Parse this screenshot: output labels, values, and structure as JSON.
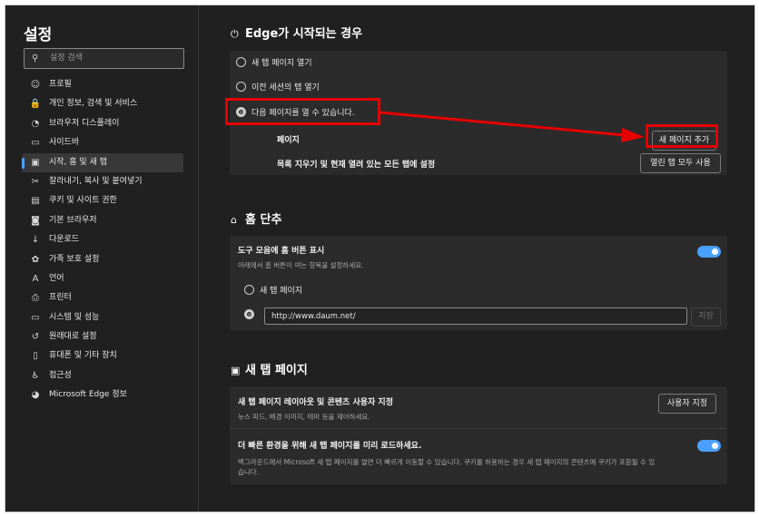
{
  "sidebar": {
    "title": "설정",
    "search_placeholder": "설정 검색",
    "items": [
      {
        "label": "프로필",
        "icon": "☺"
      },
      {
        "label": "개인 정보, 검색 및 서비스",
        "icon": "🔒"
      },
      {
        "label": "브라우저 디스플레이",
        "icon": "◔"
      },
      {
        "label": "사이드바",
        "icon": "▭"
      },
      {
        "label": "시작, 홈 및 새 탭",
        "icon": "▣"
      },
      {
        "label": "잘라내기, 복사 및 붙여넣기",
        "icon": "✂"
      },
      {
        "label": "쿠키 및 사이트 권한",
        "icon": "▤"
      },
      {
        "label": "기본 브라우저",
        "icon": "◙"
      },
      {
        "label": "다운로드",
        "icon": "↓"
      },
      {
        "label": "가족 보호 설정",
        "icon": "✿"
      },
      {
        "label": "언어",
        "icon": "A"
      },
      {
        "label": "프린터",
        "icon": "⎙"
      },
      {
        "label": "시스템 및 성능",
        "icon": "▭"
      },
      {
        "label": "원래대로 설정",
        "icon": "↺"
      },
      {
        "label": "휴대폰 및 기타 장치",
        "icon": "▯"
      },
      {
        "label": "접근성",
        "icon": "♿"
      },
      {
        "label": "Microsoft Edge 정보",
        "icon": "◕"
      }
    ]
  },
  "startup": {
    "title": "Edge가 시작되는 경우",
    "icon": "power-icon",
    "options": [
      "새 탭 페이지 열기",
      "이전 세션의 탭 열기",
      "다음 페이지를 열 수 있습니다."
    ],
    "pages_label": "페이지",
    "add_page_button": "새 페이지 추가",
    "clear_label": "목록 지우기 및 현재 열려 있는 모든 탭에 설정",
    "use_all_tabs_button": "열린 탭 모두 사용"
  },
  "home": {
    "title": "홈 단추",
    "show_button_label": "도구 모음에 홈 버튼 표시",
    "show_button_desc": "아래에서 홈 버튼이 여는 항목을 설정하세요.",
    "option_new_tab": "새 탭 페이지",
    "url_value": "http://www.daum.net/",
    "save_button": "저장"
  },
  "newtab": {
    "title": "새 탭 페이지",
    "customize_label": "새 탭 페이지 레이아웃 및 콘텐츠 사용자 지정",
    "customize_desc": "뉴스 피드, 배경 이미지, 테마 등을 제어하세요.",
    "customize_button": "사용자 지정",
    "preload_label": "더 빠른 환경을 위해 새 탭 페이지를 미리 로드하세요.",
    "preload_desc_1": "백그라운드에서 Microsoft 새 탭 페이지를 열면 더 빠르게 이동할 수 있습니다. 쿠키를 허용하는 경우 새 탭 페이지의 콘텐츠에 쿠키가 포함될 수 있",
    "preload_desc_2": "습니다."
  },
  "colors": {
    "accent": "#4aa0ff",
    "annotation": "#e60000",
    "background": "#202020",
    "card": "#2b2b2b"
  }
}
